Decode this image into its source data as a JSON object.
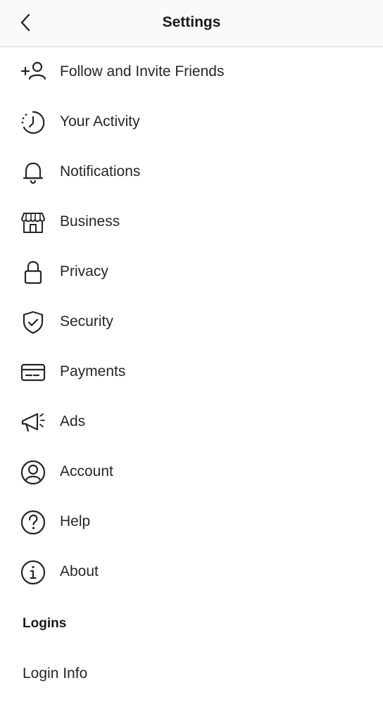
{
  "header": {
    "title": "Settings",
    "back_icon": "chevron-left-icon"
  },
  "menu": {
    "items": [
      {
        "label": "Follow and Invite Friends",
        "icon": "add-person-icon"
      },
      {
        "label": "Your Activity",
        "icon": "activity-clock-icon"
      },
      {
        "label": "Notifications",
        "icon": "bell-icon"
      },
      {
        "label": "Business",
        "icon": "storefront-icon"
      },
      {
        "label": "Privacy",
        "icon": "lock-icon"
      },
      {
        "label": "Security",
        "icon": "shield-check-icon"
      },
      {
        "label": "Payments",
        "icon": "credit-card-icon"
      },
      {
        "label": "Ads",
        "icon": "megaphone-icon"
      },
      {
        "label": "Account",
        "icon": "account-circle-icon"
      },
      {
        "label": "Help",
        "icon": "help-circle-icon"
      },
      {
        "label": "About",
        "icon": "info-circle-icon"
      }
    ]
  },
  "logins": {
    "section_title": "Logins",
    "login_info_label": "Login Info"
  }
}
